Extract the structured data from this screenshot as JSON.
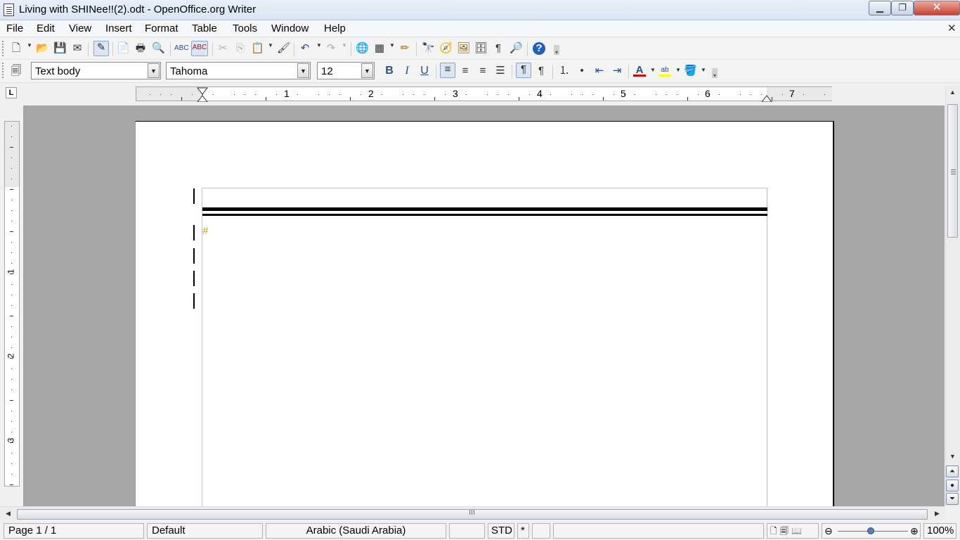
{
  "window": {
    "title": "Living with SHINee!!(2).odt - OpenOffice.org Writer",
    "min_symbol": "▁",
    "max_symbol": "❐",
    "close_symbol": "✕"
  },
  "menubar": {
    "items": [
      "File",
      "Edit",
      "View",
      "Insert",
      "Format",
      "Table",
      "Tools",
      "Window",
      "Help"
    ],
    "close_doc_symbol": "✕"
  },
  "format_toolbar": {
    "paragraph_style": "Text body",
    "font_name": "Tahoma",
    "font_size": "12",
    "bold": "B",
    "italic": "I",
    "underline": "U"
  },
  "ruler": {
    "tab_selector": "L",
    "h_numbers": [
      "1",
      "2",
      "3",
      "4",
      "5",
      "6",
      "7"
    ],
    "v_numbers": [
      "1",
      "2",
      "3"
    ]
  },
  "document": {
    "paragraph_mark": "#"
  },
  "statusbar": {
    "page": "Page 1 / 1",
    "page_style": "Default",
    "language": "Arabic (Saudi Arabia)",
    "insert_mode": "",
    "selection_mode": "STD",
    "modified": "*",
    "signature": "",
    "info": "",
    "zoom": "100%"
  },
  "icons": {
    "accent_colors": {
      "font_color": "#cc0000",
      "highlight": "#ffff00",
      "help": "#1f5fbf"
    }
  }
}
